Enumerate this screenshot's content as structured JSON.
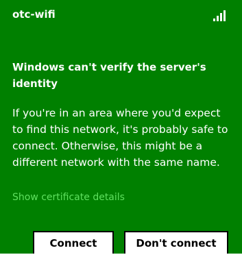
{
  "network": {
    "ssid": "otc-wifi",
    "signal_icon": "signal-strength-icon"
  },
  "dialog": {
    "heading": "Windows can't verify the server's identity",
    "message": "If you're in an area where you'd expect to find this network, it's probably safe to connect. Otherwise, this might be a different network with the same name.",
    "details_link": "Show certificate details"
  },
  "buttons": {
    "connect": "Connect",
    "dont_connect": "Don't connect"
  },
  "colors": {
    "panel_background": "#008000",
    "link": "#5fe05f",
    "text": "#ffffff",
    "button_background": "#ffffff"
  }
}
